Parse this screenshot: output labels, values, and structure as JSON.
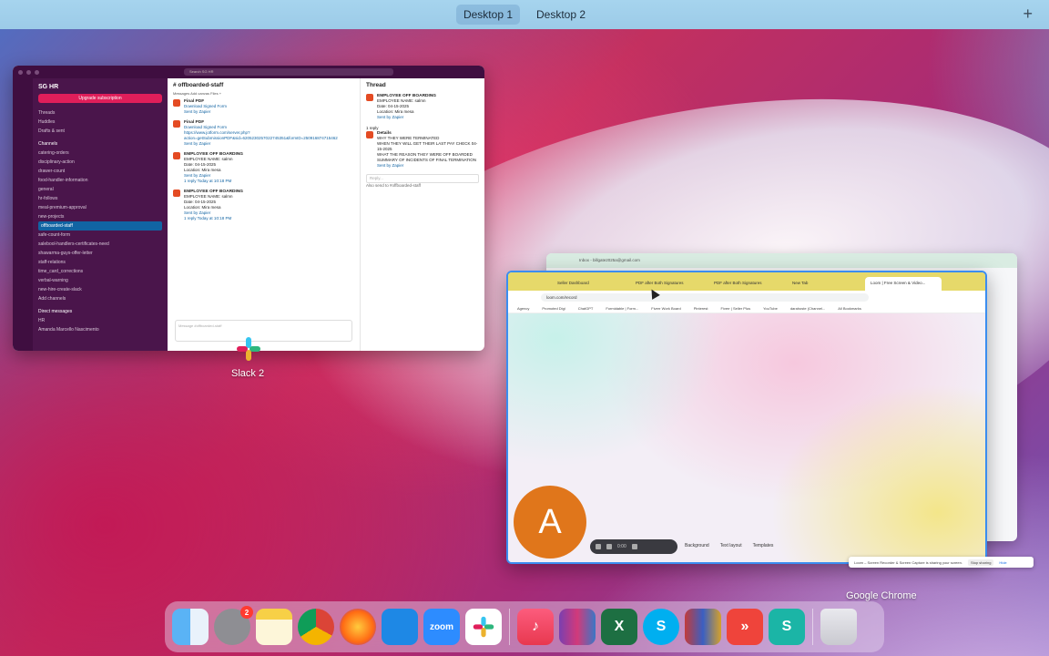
{
  "spaces": {
    "desktop1": "Desktop 1",
    "desktop2": "Desktop 2",
    "add": "+"
  },
  "slack": {
    "search": "Search SG HR",
    "workspace": "SG HR",
    "upgrade": "Upgrade subscription",
    "nav": [
      "Threads",
      "Huddles",
      "Drafts & sent"
    ],
    "channels_header": "Channels",
    "channels": [
      "catering-orders",
      "disciplinary-action",
      "drawer-count",
      "food-handler-information",
      "general",
      "hr-follows",
      "meal-premium-approval",
      "new-projects",
      "offboarded-staff",
      "safe-count-form",
      "salebool-handlers-certificates-need",
      "shawarma-guys-offer-letter",
      "staff-relations",
      "time_card_corrections",
      "verbal-warning",
      "new-hire-create-slack"
    ],
    "active_channel": "offboarded-staff",
    "add_channels": "Add channels",
    "dm_header": "Direct messages",
    "dms": [
      "HR",
      "Amanda Marcello Nascimento"
    ],
    "channel_title": "# offboarded-staff",
    "channel_tabs": "Messages   Add canvas   Files   +",
    "today": "Today",
    "messages": [
      {
        "title": "Final PDF",
        "lines": [
          "Download Signed Form",
          "Sent by Zapier"
        ]
      },
      {
        "title": "Final PDF",
        "lines": [
          "Download Signed Form",
          "https://www.jotform.com/server.php?action=getSubmissionPDF&sid=6205230257022745351&formID=250916874715462",
          "Sent by Zapier"
        ]
      },
      {
        "title": "EMPLOYEE OFF BOARDING",
        "lines": [
          "EMPLOYEE NAME: salmn",
          "Date: 04-15-2025",
          "Location: Mira mesa",
          "Sent by Zapier",
          "1 reply  Today at 10:18 PM"
        ]
      },
      {
        "title": "EMPLOYEE OFF BOARDING",
        "lines": [
          "EMPLOYEE NAME: salmn",
          "Date: 04-15-2025",
          "Location: Mira mesa",
          "Sent by Zapier",
          "1 reply  Today at 10:18 PM"
        ]
      }
    ],
    "composer": "Message #offboarded-staff",
    "thread_title": "Thread",
    "thread_msg1": {
      "title": "EMPLOYEE OFF BOARDING",
      "lines": [
        "EMPLOYEE NAME: salmn",
        "Date: 04-15-2025",
        "Location: Mira mesa",
        "Sent by Zapier"
      ]
    },
    "thread_reply_count": "1 reply",
    "thread_msg2": {
      "title": "Details",
      "lines": [
        "WHY THEY WERE TERMINATED",
        "WHEN THEY WILL GET THEIR LAST PAY CHECK 04-15-2025",
        "WHAT THE REASON THEY WERE OFF BOARDED",
        "SUMMARY OF INCIDENTS OF FINAL TERMINATION",
        "Sent by Zapier"
      ]
    },
    "thread_reply_box": "Reply...",
    "thread_also_send": "Also send to #offboarded-staff"
  },
  "labels": {
    "slack2": "Slack 2",
    "chrome": "Google Chrome"
  },
  "chrome_back": {
    "tab": "Inbox - billgate2025a@gmail.com"
  },
  "chrome": {
    "tabs": [
      "Seller Dashboard",
      "PDF after Both Signatures",
      "PDF after Both Signatures",
      "New Tab",
      "Loom | Free Screen & Video..."
    ],
    "url": "loom.com/record",
    "bookmarks": [
      "Agency",
      "Promoted Digi",
      "ChatGPT",
      "Formidable | Form...",
      "Fiverr Work Board",
      "Pinterest",
      "Fiverr | Seller Plus",
      "YouTube",
      "darahoste (Channel...",
      "All Bookmarks"
    ],
    "avatar_letter": "A",
    "rec_time": "0:00",
    "options": [
      "Background",
      "Text layout",
      "Templates"
    ]
  },
  "share_bar": {
    "text": "Loom – Screen Recorder & Screen Capture is sharing your screen.",
    "stop": "Stop sharing",
    "hide": "Hide"
  },
  "dock": {
    "apps": [
      "finder-icon",
      "system-settings-icon",
      "notes-icon",
      "chrome-icon",
      "firefox-icon",
      "vscode-icon",
      "zoom-icon",
      "slack-icon",
      "music-icon",
      "winrar-icon",
      "excel-icon",
      "skype-icon",
      "archive-icon",
      "anydesk-icon",
      "surfshark-icon",
      "trash-icon"
    ],
    "settings_badge": "2",
    "zoom_label": "zoom"
  }
}
